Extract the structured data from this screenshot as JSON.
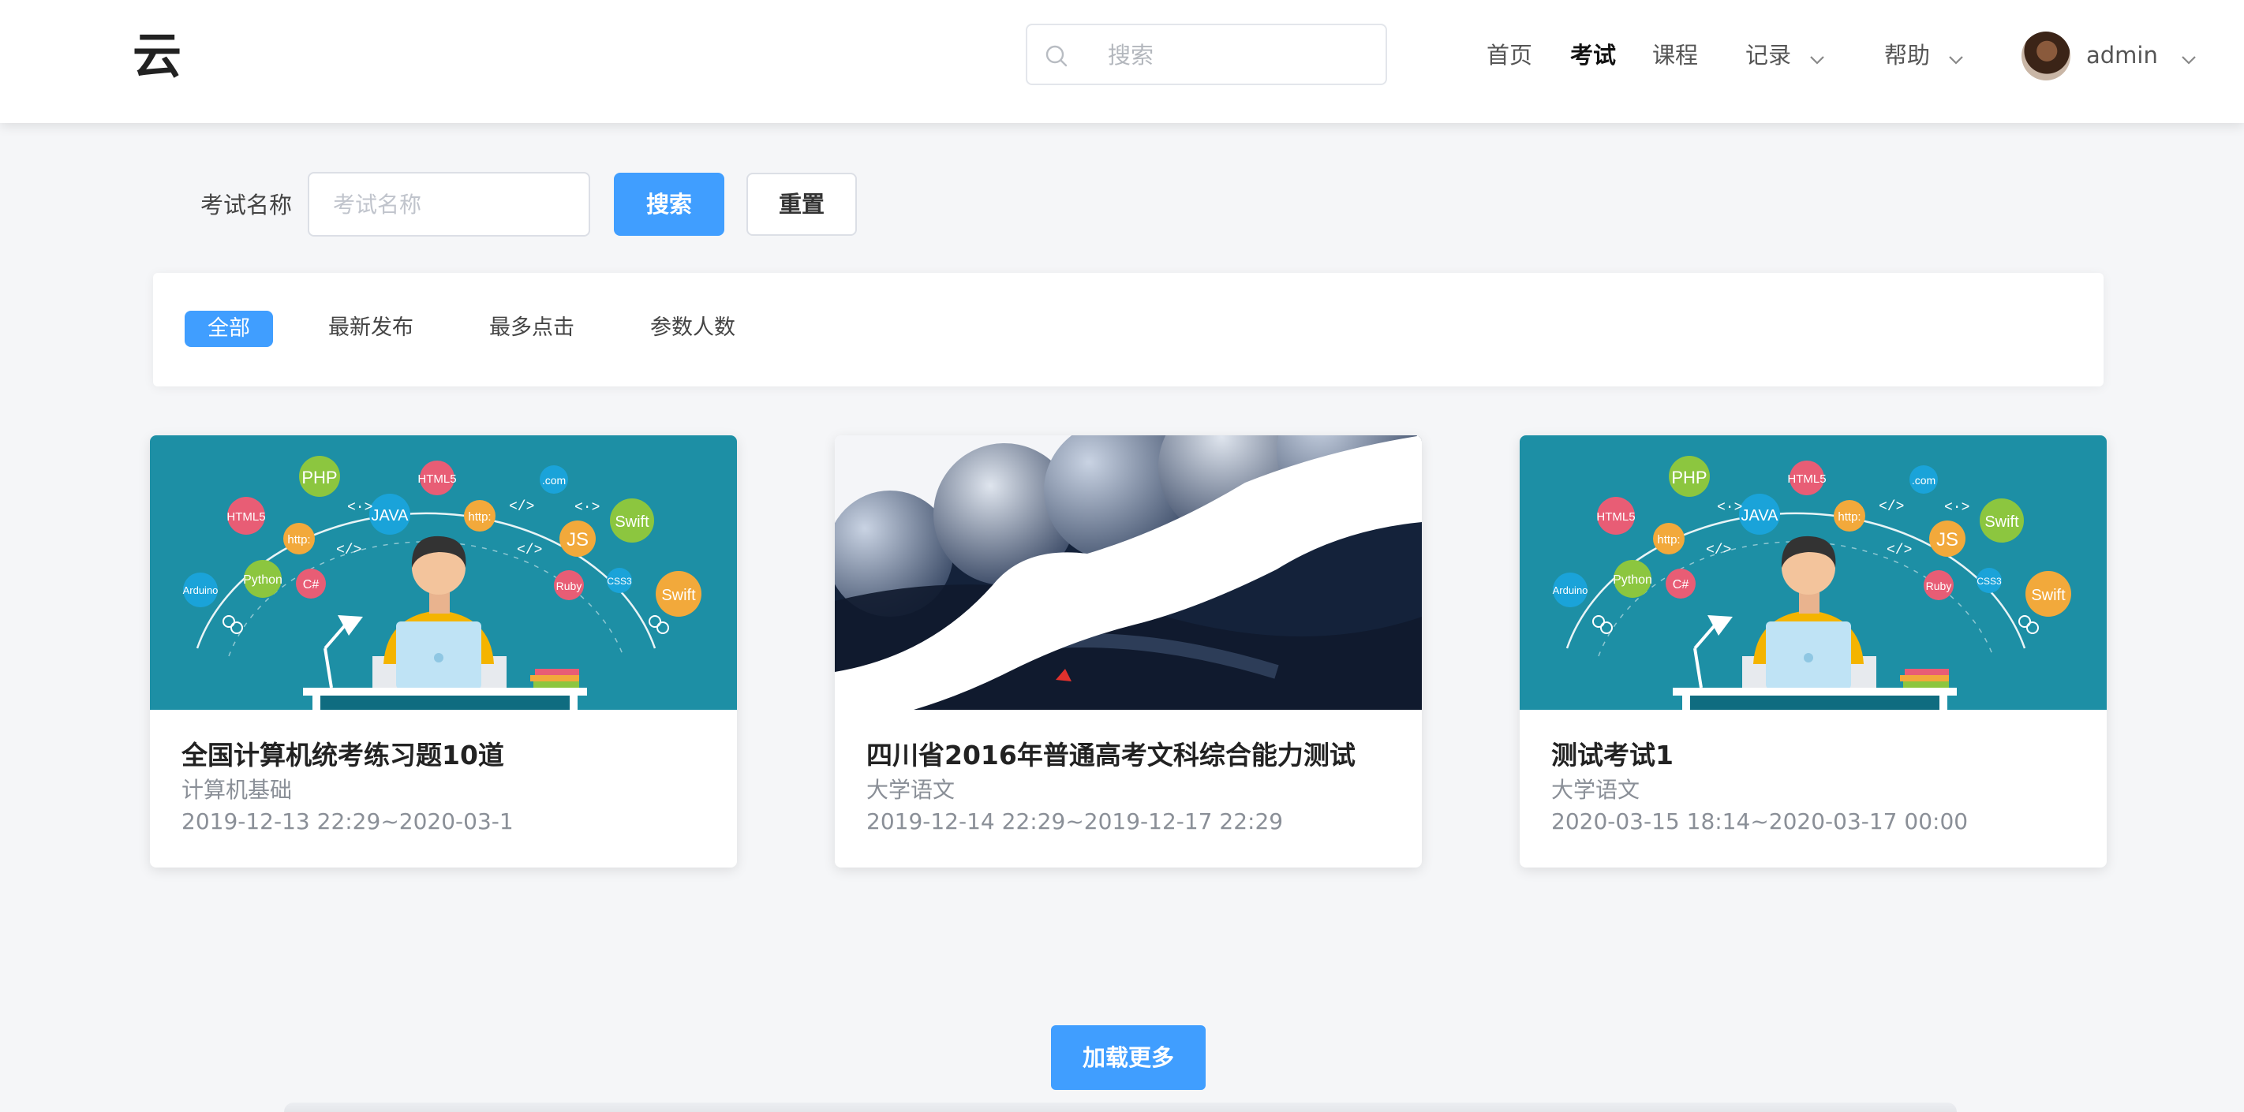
{
  "header": {
    "logo_text": "云",
    "search_placeholder": "搜索",
    "nav": [
      {
        "label": "首页",
        "active": false,
        "dropdown": false
      },
      {
        "label": "考试",
        "active": true,
        "dropdown": false
      },
      {
        "label": "课程",
        "active": false,
        "dropdown": false
      },
      {
        "label": "记录",
        "active": false,
        "dropdown": true
      },
      {
        "label": "帮助",
        "active": false,
        "dropdown": true
      }
    ],
    "user_name": "admin"
  },
  "search_form": {
    "label": "考试名称",
    "placeholder": "考试名称",
    "search_button": "搜索",
    "reset_button": "重置"
  },
  "filters": [
    "全部",
    "最新发布",
    "最多点击",
    "参数人数"
  ],
  "active_filter": "全部",
  "cards": [
    {
      "title": "全国计算机统考练习题10道",
      "category": "计算机基础",
      "time": "2019-12-13 22:29~2020-03-1",
      "image": "programming-illustration"
    },
    {
      "title": "四川省2016年普通高考文科综合能力测试",
      "category": "大学语文",
      "time": "2019-12-14 22:29~2019-12-17 22:29",
      "image": "blue-toned-photo"
    },
    {
      "title": "测试考试1",
      "category": "大学语文",
      "time": "2020-03-15 18:14~2020-03-17 00:00",
      "image": "programming-illustration"
    }
  ],
  "load_more": "加载更多",
  "colors": {
    "primary": "#409eff",
    "illustration_bg": "#1d8fa5",
    "photo_dark": "#14223a"
  }
}
